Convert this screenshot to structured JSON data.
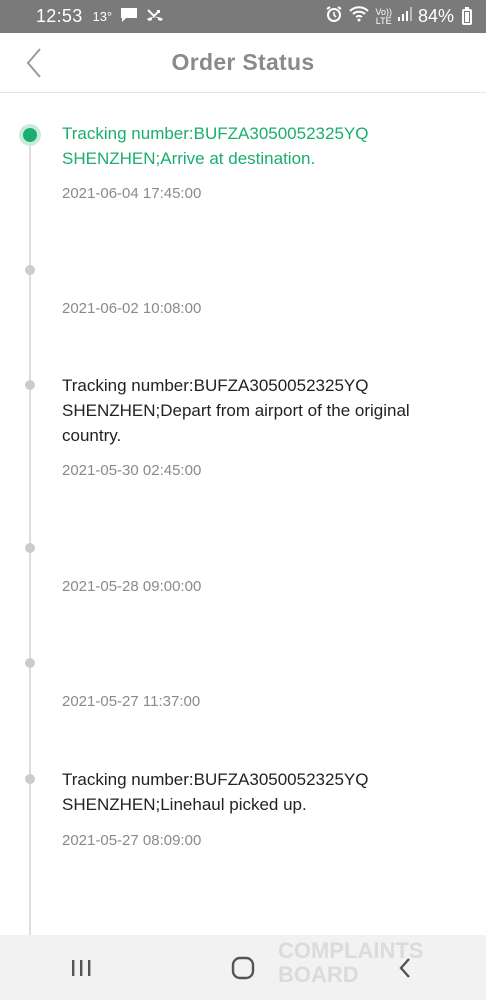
{
  "status_bar": {
    "time": "12:53",
    "temp": "13°",
    "battery": "84%",
    "volte_top": "Vo))",
    "volte_bottom": "LTE"
  },
  "header": {
    "title": "Order Status"
  },
  "timeline": [
    {
      "text_line1": "Tracking number:BUFZA3050052325YQ",
      "text_line2": "SHENZHEN;Arrive at destination.",
      "time": "2021-06-04 17:45:00",
      "active": true
    },
    {
      "text_line1": "",
      "text_line2": "",
      "time": "2021-06-02 10:08:00",
      "active": false
    },
    {
      "text_line1": "Tracking number:BUFZA3050052325YQ",
      "text_line2": "SHENZHEN;Depart from airport of the original country.",
      "time": "2021-05-30 02:45:00",
      "active": false
    },
    {
      "text_line1": "",
      "text_line2": "",
      "time": "2021-05-28 09:00:00",
      "active": false
    },
    {
      "text_line1": "",
      "text_line2": "",
      "time": "2021-05-27 11:37:00",
      "active": false
    },
    {
      "text_line1": "Tracking number:BUFZA3050052325YQ",
      "text_line2": "SHENZHEN;Linehaul picked up.",
      "time": "2021-05-27 08:09:00",
      "active": false
    }
  ],
  "watermark": {
    "line1": "COMPLAINTS",
    "line2": "BOARD"
  },
  "colors": {
    "accent": "#1aae6f",
    "status_bar": "#7a7a7a",
    "title": "#8a8a8a"
  }
}
